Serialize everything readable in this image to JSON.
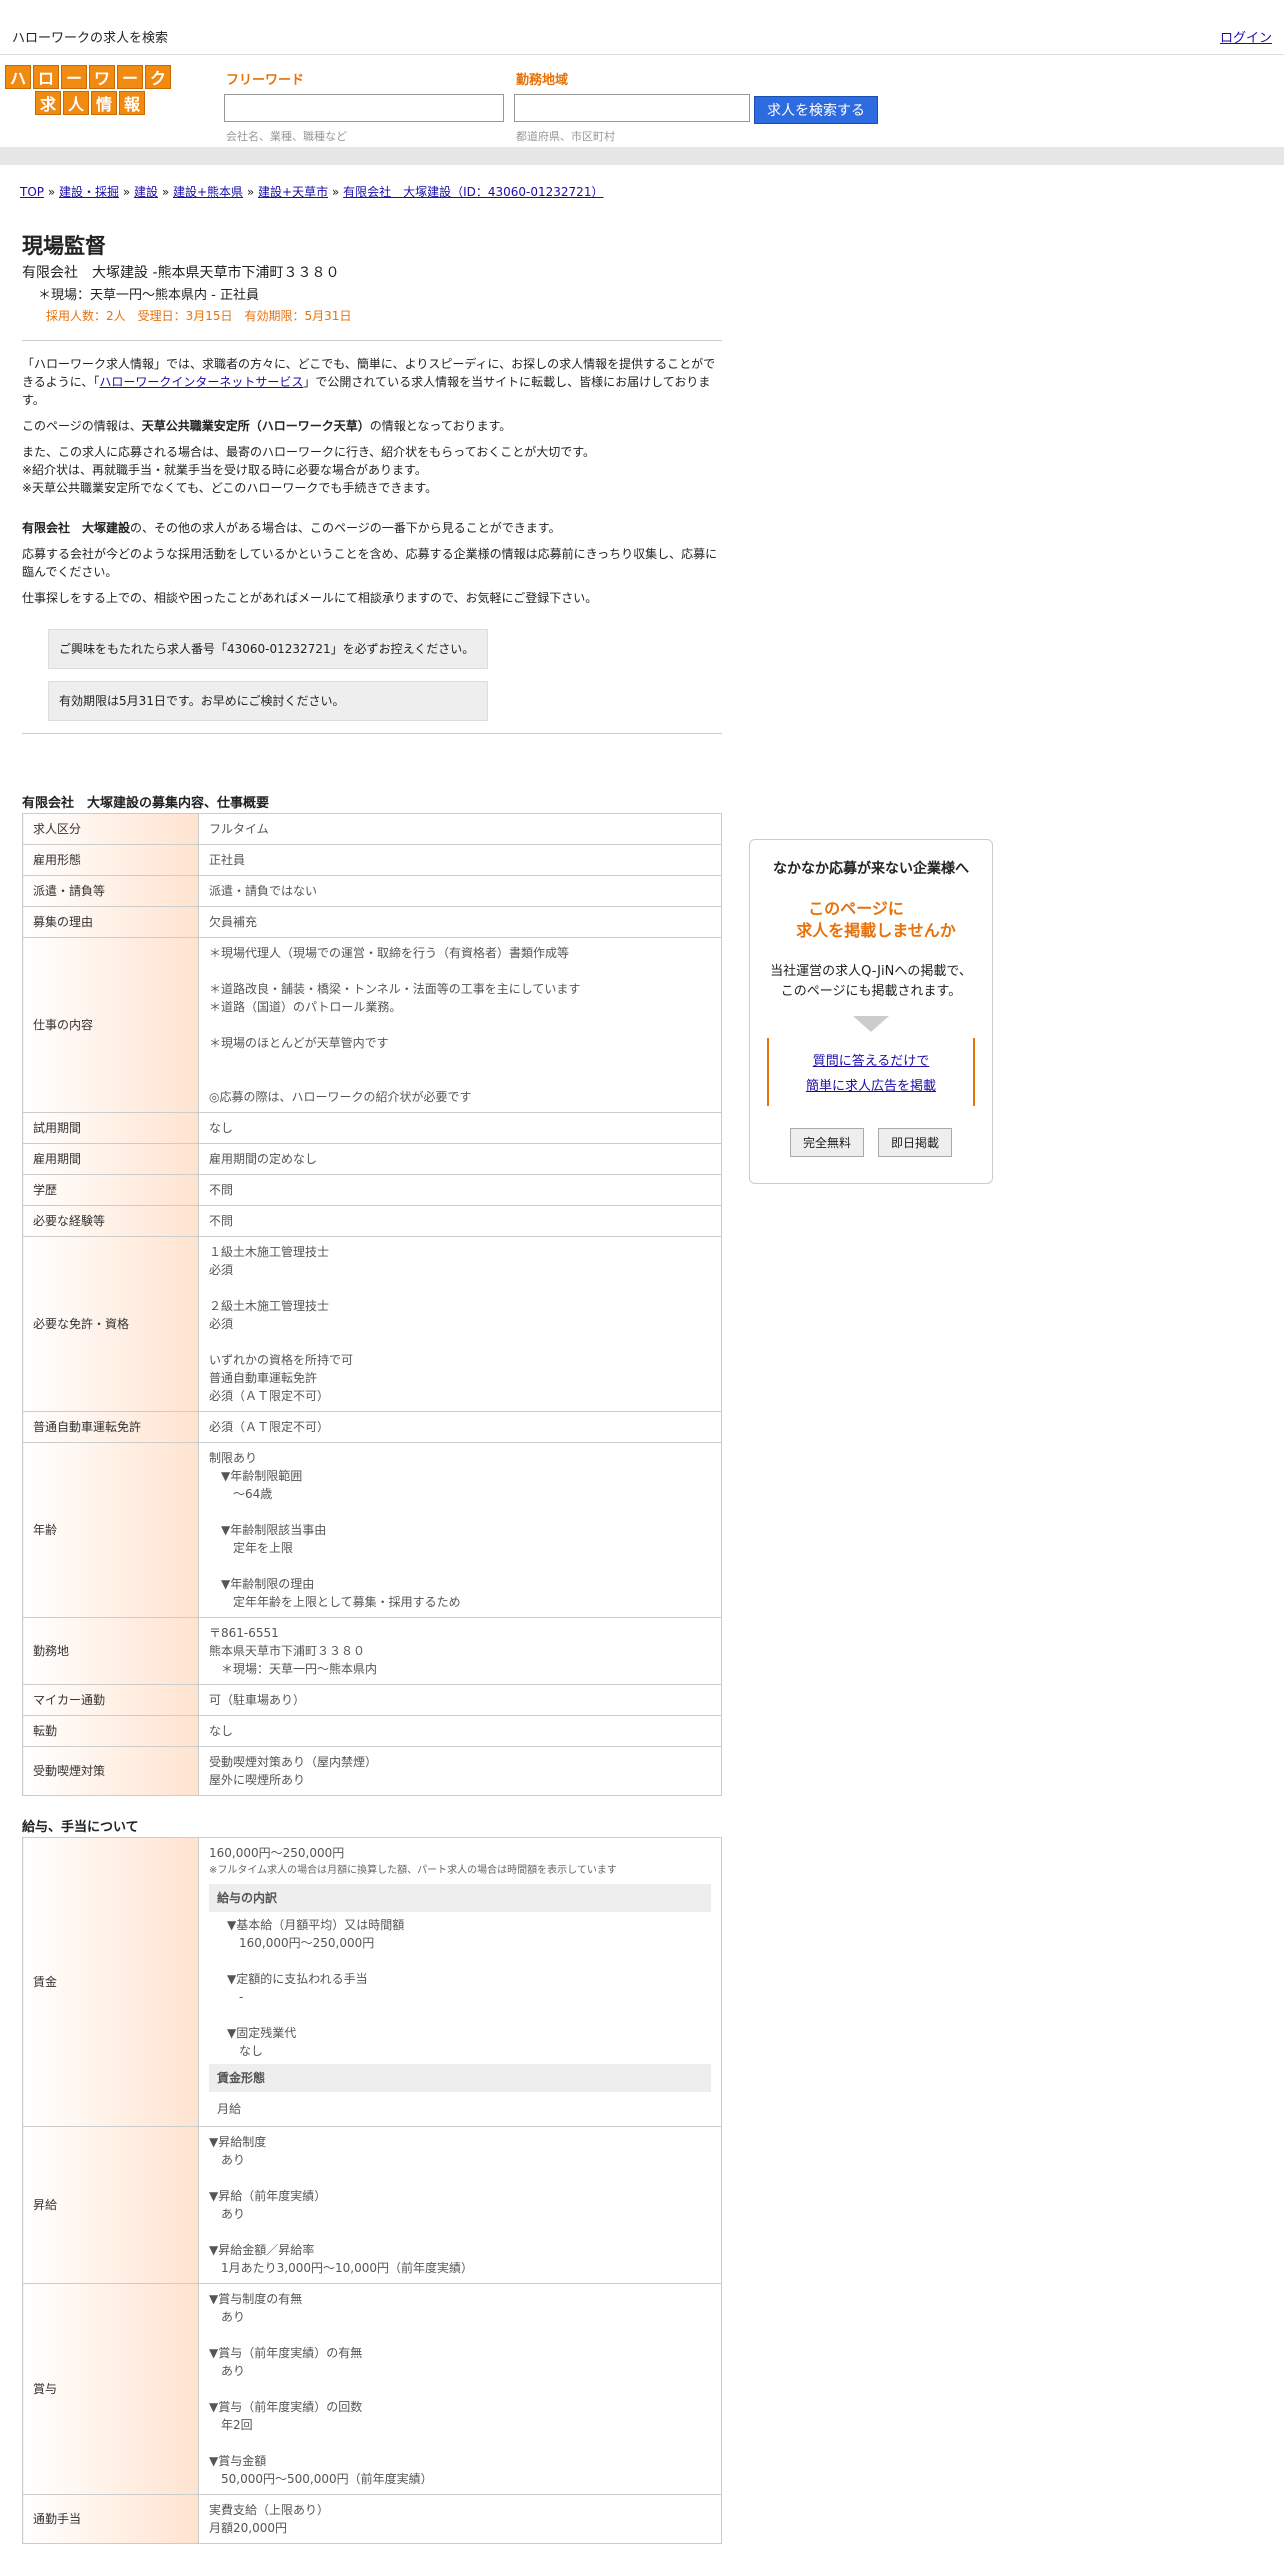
{
  "topbar": {
    "site_title": "ハローワークの求人を検索",
    "login": "ログイン"
  },
  "logo": {
    "row1": [
      "ハ",
      "ロ",
      "ー",
      "ワ",
      "ー",
      "ク"
    ],
    "row2": [
      "求",
      "人",
      "情",
      "報"
    ]
  },
  "search": {
    "freeword_label": "フリーワード",
    "freeword_placeholder": "会社名、業種、職種など",
    "area_label": "勤務地域",
    "area_placeholder": "都道府県、市区町村",
    "button": "求人を検索する"
  },
  "breadcrumb": {
    "items": [
      "TOP",
      "建設・採掘",
      "建設",
      "建設+熊本県",
      "建設+天草市",
      "有限会社　大塚建設（ID：43060-01232721）"
    ],
    "sep": " » "
  },
  "job": {
    "title": "現場監督",
    "company_line": "有限会社　大塚建設 -熊本県天草市下浦町３３８０",
    "location_line": "＊現場：天草一円～熊本県内 - 正社員",
    "meta": "採用人数：2人　受理日：3月15日　有効期限：5月31日"
  },
  "intro": {
    "p1_a": "「ハローワーク求人情報」では、求職者の方々に、どこでも、簡単に、よりスピーディに、お探しの求人情報を提供することができるように、「",
    "p1_link": "ハローワークインターネットサービス",
    "p1_b": "」で公開されている求人情報を当サイトに転載し、皆様にお届けしております。",
    "p2_a": "このページの情報は、",
    "p2_bold": "天草公共職業安定所（ハローワーク天草）",
    "p2_b": "の情報となっております。",
    "p3_1": "また、この求人に応募される場合は、最寄のハローワークに行き、紹介状をもらっておくことが大切です。",
    "p3_2": "※紹介状は、再就職手当・就業手当を受け取る時に必要な場合があります。",
    "p3_3": "※天草公共職業安定所でなくても、どこのハローワークでも手続きできます。",
    "p4_bold": "有限会社　大塚建設",
    "p4_b": "の、その他の求人がある場合は、このページの一番下から見ることができます。",
    "p5": "応募する会社が今どのような採用活動をしているかということを含め、応募する企業様の情報は応募前にきっちり収集し、応募に臨んでください。",
    "p6": "仕事探しをする上での、相談や困ったことがあればメールにて相談承りますので、お気軽にご登録下さい。",
    "note1": "ご興味をもたれたら求人番号「43060-01232721」を必ずお控えください。",
    "note2": "有効期限は5月31日です。お早めにご検討ください。"
  },
  "section1_title": "有限会社　大塚建設の募集内容、仕事概要",
  "table1": [
    {
      "k": "求人区分",
      "v": [
        "フルタイム"
      ]
    },
    {
      "k": "雇用形態",
      "v": [
        "正社員"
      ]
    },
    {
      "k": "派遣・請負等",
      "v": [
        "派遣・請負ではない"
      ]
    },
    {
      "k": "募集の理由",
      "v": [
        "欠員補充"
      ]
    },
    {
      "k": "仕事の内容",
      "v": [
        "＊現場代理人（現場での運営・取締を行う（有資格者）書類作成等",
        "",
        "＊道路改良・舗装・橋梁・トンネル・法面等の工事を主にしています",
        "＊道路（国道）のパトロール業務。",
        "",
        "＊現場のほとんどが天草管内です",
        "",
        "",
        "◎応募の際は、ハローワークの紹介状が必要です"
      ]
    },
    {
      "k": "試用期間",
      "v": [
        "なし"
      ]
    },
    {
      "k": "雇用期間",
      "v": [
        "雇用期間の定めなし"
      ]
    },
    {
      "k": "学歴",
      "v": [
        "不問"
      ]
    },
    {
      "k": "必要な経験等",
      "v": [
        "不問"
      ]
    },
    {
      "k": "必要な免許・資格",
      "v": [
        "１級土木施工管理技士",
        "必須",
        "",
        "２級土木施工管理技士",
        "必須",
        "",
        "いずれかの資格を所持で可",
        "普通自動車運転免許",
        "必須（ＡＴ限定不可）"
      ]
    },
    {
      "k": "普通自動車運転免許",
      "v": [
        "必須（ＡＴ限定不可）"
      ]
    },
    {
      "k": "年齢",
      "v": [
        "制限あり",
        "　▼年齢制限範囲",
        "　　〜64歳",
        "",
        "　▼年齢制限該当事由",
        "　　定年を上限",
        "",
        "　▼年齢制限の理由",
        "　　定年年齢を上限として募集・採用するため"
      ]
    },
    {
      "k": "勤務地",
      "v": [
        "〒861-6551",
        "熊本県天草市下浦町３３８０",
        "　＊現場：天草一円～熊本県内"
      ]
    },
    {
      "k": "マイカー通勤",
      "v": [
        "可（駐車場あり）"
      ]
    },
    {
      "k": "転勤",
      "v": [
        "なし"
      ]
    },
    {
      "k": "受動喫煙対策",
      "v": [
        "受動喫煙対策あり（屋内禁煙）",
        "屋外に喫煙所あり"
      ]
    }
  ],
  "section2_title": "給与、手当について",
  "wage": {
    "k": "賃金",
    "range": "160,000円〜250,000円",
    "note": "※フルタイム求人の場合は月額に換算した額、パート求人の場合は時間額を表示しています",
    "breakdown_title": "給与の内訳",
    "breakdown": [
      "▼基本給（月額平均）又は時間額",
      "　160,000円〜250,000円",
      "",
      "▼定額的に支払われる手当",
      "　-",
      "",
      "▼固定残業代",
      "　なし"
    ],
    "form_title": "賃金形態",
    "form": "月給"
  },
  "table2": [
    {
      "k": "昇給",
      "v": [
        "▼昇給制度",
        "　あり",
        "",
        "▼昇給（前年度実績）",
        "　あり",
        "",
        "▼昇給金額／昇給率",
        "　1月あたり3,000円〜10,000円（前年度実績）"
      ]
    },
    {
      "k": "賞与",
      "v": [
        "▼賞与制度の有無",
        "　あり",
        "",
        "▼賞与（前年度実績）の有無",
        "　あり",
        "",
        "▼賞与（前年度実績）の回数",
        "　年2回",
        "",
        "▼賞与金額",
        "　50,000円〜500,000円（前年度実績）"
      ]
    },
    {
      "k": "通勤手当",
      "v": [
        "実費支給（上限あり）",
        "月額20,000円"
      ]
    }
  ],
  "side": {
    "title": "なかなか応募が来ない企業様へ",
    "catch1": "このページに",
    "catch2": "求人を掲載しませんか",
    "desc1": "当社運営の求人Q-JiNへの掲載で、",
    "desc2": "このページにも掲載されます。",
    "link1": "質問に答えるだけで",
    "link2": "簡単に求人広告を掲載",
    "btn1": "完全無料",
    "btn2": "即日掲載"
  }
}
